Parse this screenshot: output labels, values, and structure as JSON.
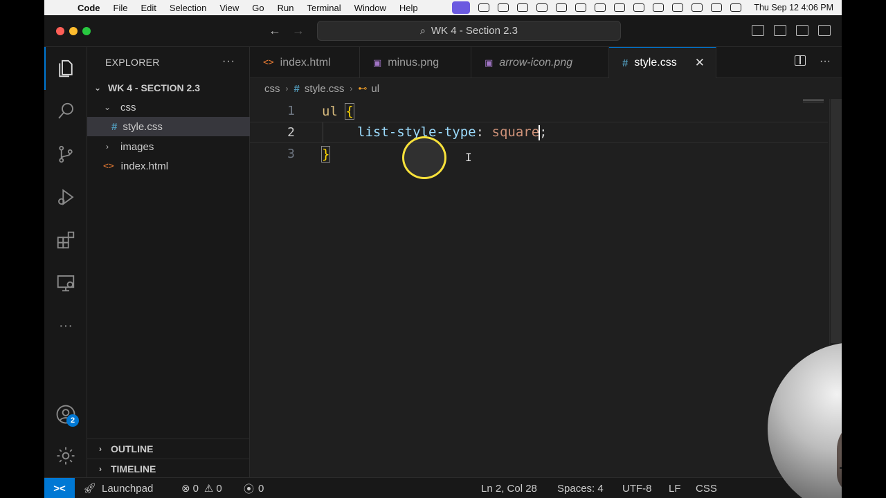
{
  "menubar": {
    "apple": "",
    "app_name": "Code",
    "menus": [
      "File",
      "Edit",
      "Selection",
      "View",
      "Go",
      "Run",
      "Terminal",
      "Window",
      "Help"
    ],
    "clock": "Thu Sep 12  4:06 PM"
  },
  "titlebar": {
    "search": "WK 4 - Section 2.3",
    "back_arrow": "←",
    "forward_arrow": "→"
  },
  "activity": {
    "account_badge": "2",
    "more": "···"
  },
  "sidebar": {
    "title": "EXPLORER",
    "more": "···",
    "root": "WK 4 - SECTION 2.3",
    "tree": {
      "css_folder": "css",
      "style_file": "style.css",
      "images_folder": "images",
      "index_file": "index.html"
    },
    "outline": "OUTLINE",
    "timeline": "TIMELINE"
  },
  "tabs": [
    {
      "label": "index.html",
      "icon": "html-icon"
    },
    {
      "label": "minus.png",
      "icon": "image-icon"
    },
    {
      "label": "arrow-icon.png",
      "icon": "image-icon"
    },
    {
      "label": "style.css",
      "icon": "css-icon",
      "active": true
    }
  ],
  "tab_close": "✕",
  "tab_more": "···",
  "breadcrumb": {
    "folder": "css",
    "file": "style.css",
    "symbol": "ul"
  },
  "code": {
    "line_numbers": [
      "1",
      "2",
      "3"
    ],
    "l1_selector": "ul",
    "l1_brace": "{",
    "l2_property": "list-style-type",
    "l2_colon": ":",
    "l2_value": "square",
    "l2_semi": ";",
    "l3_brace": "}"
  },
  "statusbar": {
    "remote": "><",
    "launchpad": "Launchpad",
    "errors": "0",
    "warnings": "0",
    "ports": "0",
    "position": "Ln 2, Col 28",
    "spaces": "Spaces: 4",
    "encoding": "UTF-8",
    "eol": "LF",
    "language": "CSS"
  },
  "colors": {
    "accent": "#0078d4",
    "selector": "#d7ba7d",
    "property": "#9cdcfe",
    "value": "#ce9178",
    "bracket": "#ffd700",
    "cursor_ring": "#f7e13a"
  }
}
